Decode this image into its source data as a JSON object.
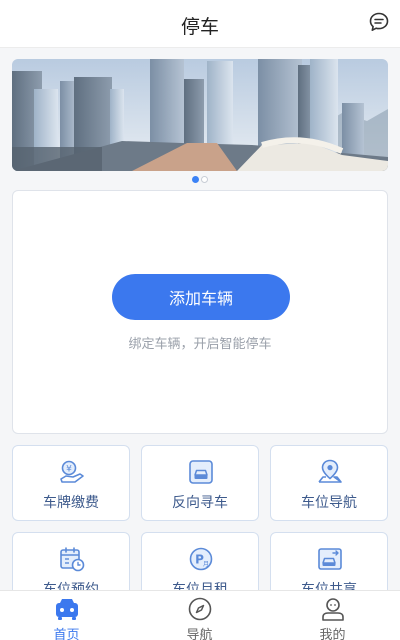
{
  "header": {
    "title": "停车",
    "message_icon": "chat-bubble-icon"
  },
  "banner": {
    "image": "city-skyline-banner",
    "page_count": 2,
    "active_page": 1
  },
  "vehicle": {
    "add_button_label": "添加车辆",
    "hint": "绑定车辆，开启智能停车"
  },
  "services": [
    {
      "label": "车牌缴费",
      "icon": "plate-payment-icon"
    },
    {
      "label": "反向寻车",
      "icon": "find-car-icon"
    },
    {
      "label": "车位导航",
      "icon": "location-pin-icon"
    },
    {
      "label": "车位预约",
      "icon": "calendar-clock-icon"
    },
    {
      "label": "车位月租",
      "icon": "parking-monthly-icon"
    },
    {
      "label": "车位共享",
      "icon": "share-space-icon"
    }
  ],
  "tabbar": {
    "items": [
      {
        "label": "首页",
        "icon": "home-car-icon",
        "active": true
      },
      {
        "label": "导航",
        "icon": "compass-icon",
        "active": false
      },
      {
        "label": "我的",
        "icon": "user-icon",
        "active": false
      }
    ]
  },
  "colors": {
    "accent": "#3b78ee",
    "tile_text": "#3d5a8c",
    "tile_border": "#d4dfef",
    "hint": "#9aa0aa"
  }
}
